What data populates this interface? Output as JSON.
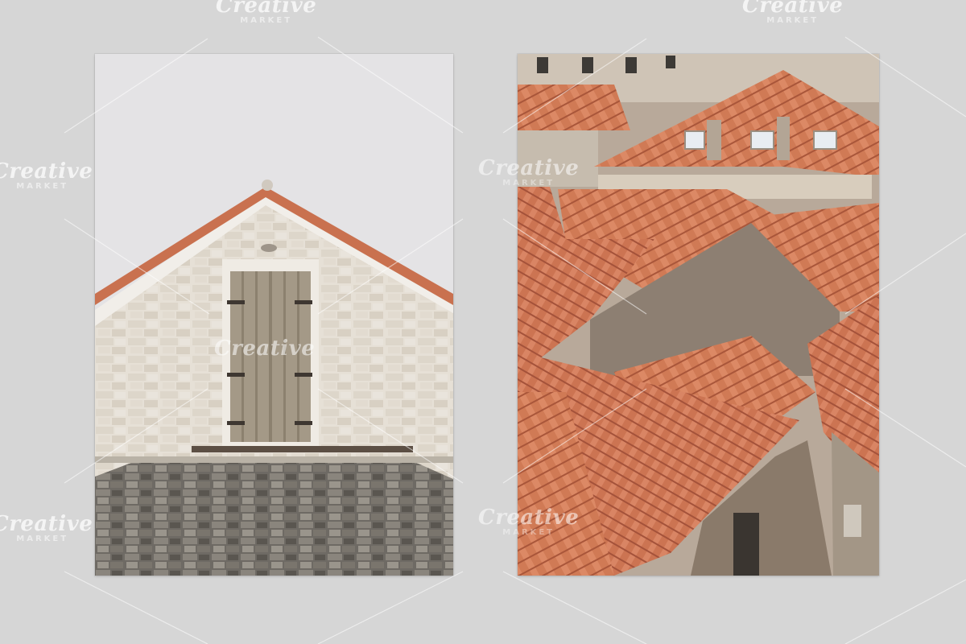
{
  "watermark": {
    "brand": "Creative",
    "sub": "MARKET"
  },
  "photos": [
    {
      "subject": "white-stone-gable-with-wooden-shutters"
    },
    {
      "subject": "terracotta-tiled-rooftops"
    }
  ],
  "colors": {
    "background": "#d6d6d6",
    "terracotta": "#c9714f",
    "stone": "#e7e1d8",
    "sky": "#e4e3e5"
  }
}
